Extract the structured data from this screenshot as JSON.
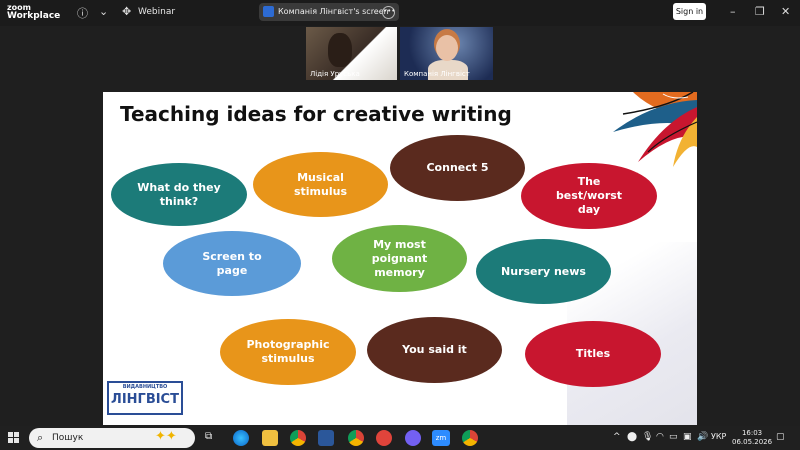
{
  "app": {
    "logo_line1": "zoom",
    "logo_line2": "Workplace",
    "mode_label": "Webinar",
    "sign_in": "Sign in"
  },
  "share": {
    "label": "Компанія Лінгвіст's screen"
  },
  "participants": [
    {
      "name": "Лідія Уруська"
    },
    {
      "name": "Компанія Лінгвіст"
    }
  ],
  "slide": {
    "title": "Teaching ideas for creative writing",
    "ideas": [
      {
        "label": "What do they\nthink?",
        "color": "#1c7b79"
      },
      {
        "label": "Musical\nstimulus",
        "color": "#e8951a"
      },
      {
        "label": "Connect 5",
        "color": "#5a2a1e"
      },
      {
        "label": "The\nbest/worst\nday",
        "color": "#c8162f"
      },
      {
        "label": "Screen to\npage",
        "color": "#5b9bd8"
      },
      {
        "label": "My most\npoignant\nmemory",
        "color": "#6fb244"
      },
      {
        "label": "Nursery news",
        "color": "#1c7b79"
      },
      {
        "label": "Photographic\nstimulus",
        "color": "#e8951a"
      },
      {
        "label": "You said it",
        "color": "#5a2a1e"
      },
      {
        "label": "Titles",
        "color": "#c8162f"
      }
    ],
    "publisher": {
      "small": "ВИДАВНИЦТВО",
      "big": "ЛІНГВІСТ"
    }
  },
  "taskbar": {
    "search_placeholder": "Пошук",
    "lang": "УКР",
    "time": "16:03",
    "date": "06.05.2026"
  }
}
